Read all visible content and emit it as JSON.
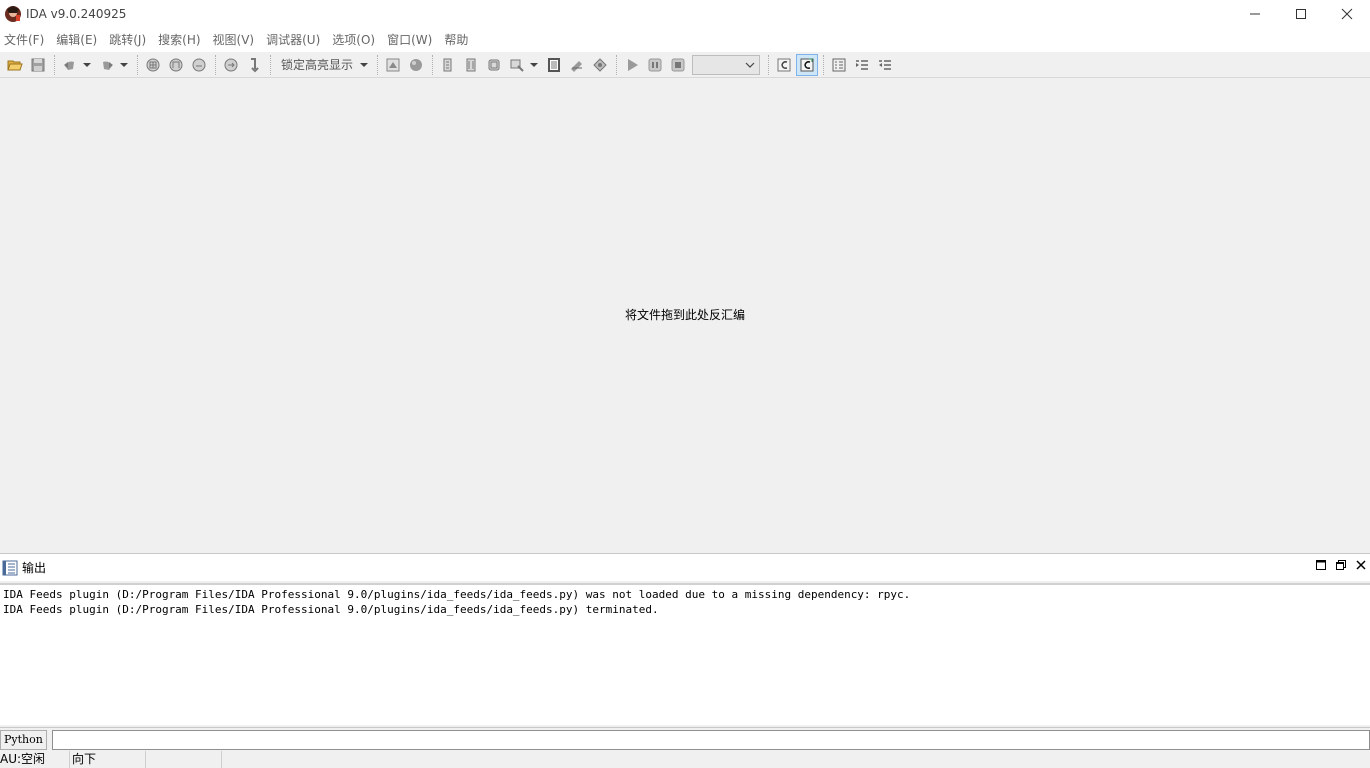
{
  "window": {
    "title": "IDA v9.0.240925"
  },
  "menu": [
    "文件(F)",
    "编辑(E)",
    "跳转(J)",
    "搜索(H)",
    "视图(V)",
    "调试器(U)",
    "选项(O)",
    "窗口(W)",
    "帮助"
  ],
  "toolbar": {
    "highlight_mode": "锁定高亮显示"
  },
  "workspace": {
    "drop_hint": "将文件拖到此处反汇编"
  },
  "output": {
    "title": "输出",
    "lines": [
      "IDA Feeds plugin (D:/Program Files/IDA Professional 9.0/plugins/ida_feeds/ida_feeds.py) was not loaded due to a missing dependency: rpyc.",
      "IDA Feeds plugin (D:/Program Files/IDA Professional 9.0/plugins/ida_feeds/ida_feeds.py) terminated."
    ]
  },
  "cli": {
    "language_button": "Python",
    "input_value": ""
  },
  "status": {
    "au": "AU:空闲",
    "direction": "向下",
    "extra": ""
  }
}
